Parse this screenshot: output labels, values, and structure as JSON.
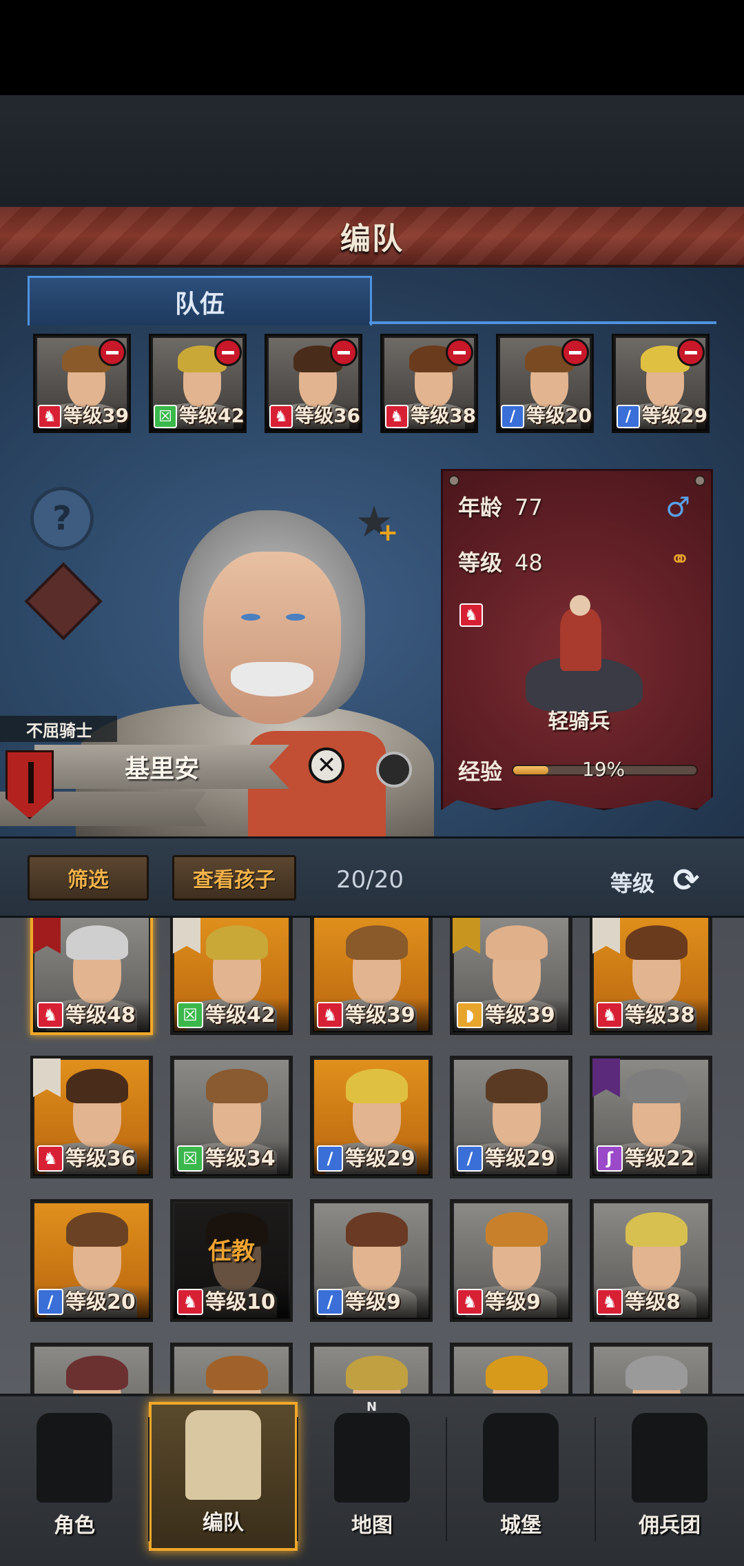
{
  "header": {
    "title": "编队"
  },
  "tabs": [
    {
      "label": "队伍"
    }
  ],
  "team": [
    {
      "level_text": "等级39",
      "class_icon": "beast-icon",
      "hair": "#8a5a2a",
      "flag": true
    },
    {
      "level_text": "等级42",
      "class_icon": "crossed-x-icon",
      "hair": "#c9a838"
    },
    {
      "level_text": "等级36",
      "class_icon": "beast-icon",
      "hair": "#4a2c1a"
    },
    {
      "level_text": "等级38",
      "class_icon": "beast-icon",
      "hair": "#6b3b1d"
    },
    {
      "level_text": "等级20",
      "class_icon": "sword-icon",
      "hair": "#7a4a22"
    },
    {
      "level_text": "等级29",
      "class_icon": "sword-icon",
      "hair": "#e0c040"
    }
  ],
  "hero": {
    "title": "不屈骑士",
    "name": "基里安"
  },
  "info": {
    "age_label": "年龄",
    "age_value": "77",
    "level_label": "等级",
    "level_value": "48",
    "unit_name": "轻骑兵",
    "exp_label": "经验",
    "exp_percent_text": "19%",
    "exp_fraction": 0.19,
    "gender_icon": "male-icon",
    "marriage_icon": "rings-icon"
  },
  "filter_bar": {
    "filter_label": "筛选",
    "children_label": "查看孩子",
    "count_text": "20/20",
    "sort_label": "等级"
  },
  "roster": [
    {
      "level_text": "等级48",
      "class_icon": "beast-icon",
      "bg": "gray",
      "hair": "#cfcfcf",
      "selected": true,
      "pennant": "red"
    },
    {
      "level_text": "等级42",
      "class_icon": "crossed-x-icon",
      "bg": "orange",
      "hair": "#c9a838",
      "pennant": "white"
    },
    {
      "level_text": "等级39",
      "class_icon": "beast-icon",
      "bg": "orange",
      "hair": "#8a5a2a"
    },
    {
      "level_text": "等级39",
      "class_icon": "shield-icon",
      "bg": "gray",
      "hair": "#e0b08a",
      "pennant": "gold"
    },
    {
      "level_text": "等级38",
      "class_icon": "beast-icon",
      "bg": "orange",
      "hair": "#6b3b1d",
      "pennant": "white"
    },
    {
      "level_text": "等级36",
      "class_icon": "beast-icon",
      "bg": "orange",
      "hair": "#4a2c1a",
      "pennant": "white"
    },
    {
      "level_text": "等级34",
      "class_icon": "crossed-x-icon",
      "bg": "gray",
      "hair": "#8a5a30"
    },
    {
      "level_text": "等级29",
      "class_icon": "sword-icon",
      "bg": "orange",
      "hair": "#e0c040"
    },
    {
      "level_text": "等级29",
      "class_icon": "sword-icon",
      "bg": "gray",
      "hair": "#5a3a22"
    },
    {
      "level_text": "等级22",
      "class_icon": "staff-icon",
      "bg": "gray",
      "hair": "#7d7d7d",
      "pennant": "purple"
    },
    {
      "level_text": "等级20",
      "class_icon": "sword-icon",
      "bg": "orange",
      "hair": "#6b4324"
    },
    {
      "level_text": "等级10",
      "class_icon": "beast-icon",
      "bg": "dark",
      "hair": "#3a2a1c",
      "overlay": "任教"
    },
    {
      "level_text": "等级9",
      "class_icon": "sword-icon",
      "bg": "gray",
      "hair": "#6a3a24"
    },
    {
      "level_text": "等级9",
      "class_icon": "beast-icon",
      "bg": "gray",
      "hair": "#c8812a"
    },
    {
      "level_text": "等级8",
      "class_icon": "beast-icon",
      "bg": "gray",
      "hair": "#d8c050"
    },
    {
      "level_text": "",
      "class_icon": "",
      "bg": "gray",
      "hair": "#6b3030"
    },
    {
      "level_text": "",
      "class_icon": "",
      "bg": "gray",
      "hair": "#a0622a"
    },
    {
      "level_text": "",
      "class_icon": "",
      "bg": "gray",
      "hair": "#c0a040"
    },
    {
      "level_text": "",
      "class_icon": "",
      "bg": "gray",
      "hair": "#d89a1a"
    },
    {
      "level_text": "",
      "class_icon": "",
      "bg": "gray",
      "hair": "#9a9a9a"
    }
  ],
  "nav": [
    {
      "label": "角色",
      "icon": "knight-helmet-icon",
      "active": false
    },
    {
      "label": "编队",
      "icon": "formation-helmet-icon",
      "active": true
    },
    {
      "label": "地图",
      "icon": "compass-map-icon",
      "active": false
    },
    {
      "label": "城堡",
      "icon": "castle-icon",
      "active": false
    },
    {
      "label": "佣兵团",
      "icon": "mercenary-icon",
      "active": false
    }
  ],
  "compass_letter": "N"
}
